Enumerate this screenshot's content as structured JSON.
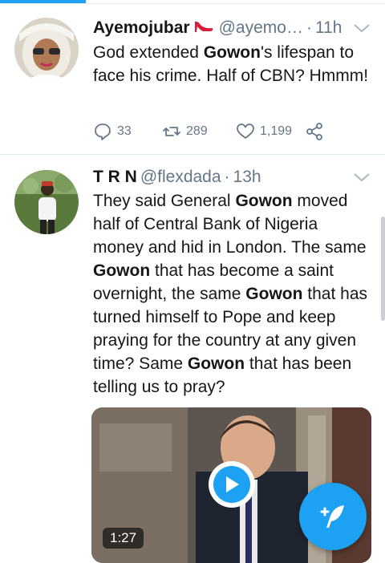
{
  "colors": {
    "accent": "#1da1f2",
    "text": "#14171a",
    "secondary": "#657786"
  },
  "tweets": [
    {
      "name": "Ayemojubar",
      "handle": "@ayemo…",
      "time": "11h",
      "text": {
        "p1": "God extended ",
        "b1": "Gowon",
        "p2": "'s lifespan to face his crime. Half of CBN? Hmmm!"
      },
      "replies": "33",
      "retweets": "289",
      "likes": "1,199"
    },
    {
      "name": "T R N",
      "handle": "@flexdada",
      "time": "13h",
      "text": {
        "p1": "They said General ",
        "b1": "Gowon",
        "p2": " moved half of Central Bank of Nigeria money and hid in London. The same ",
        "b2": "Gowon",
        "p3": " that has become a saint overnight, the same ",
        "b3": "Gowon",
        "p4": " that has turned himself to Pope and keep praying for the country at any given time? Same ",
        "b4": "Gowon",
        "p5": " that has been telling us to pray?"
      },
      "video_duration": "1:27"
    }
  ],
  "icons": {
    "reply": "reply-icon",
    "retweet": "retweet-icon",
    "like": "heart-icon",
    "share": "share-icon",
    "compose": "compose-tweet-icon",
    "play": "play-icon",
    "caret": "chevron-down-icon"
  }
}
